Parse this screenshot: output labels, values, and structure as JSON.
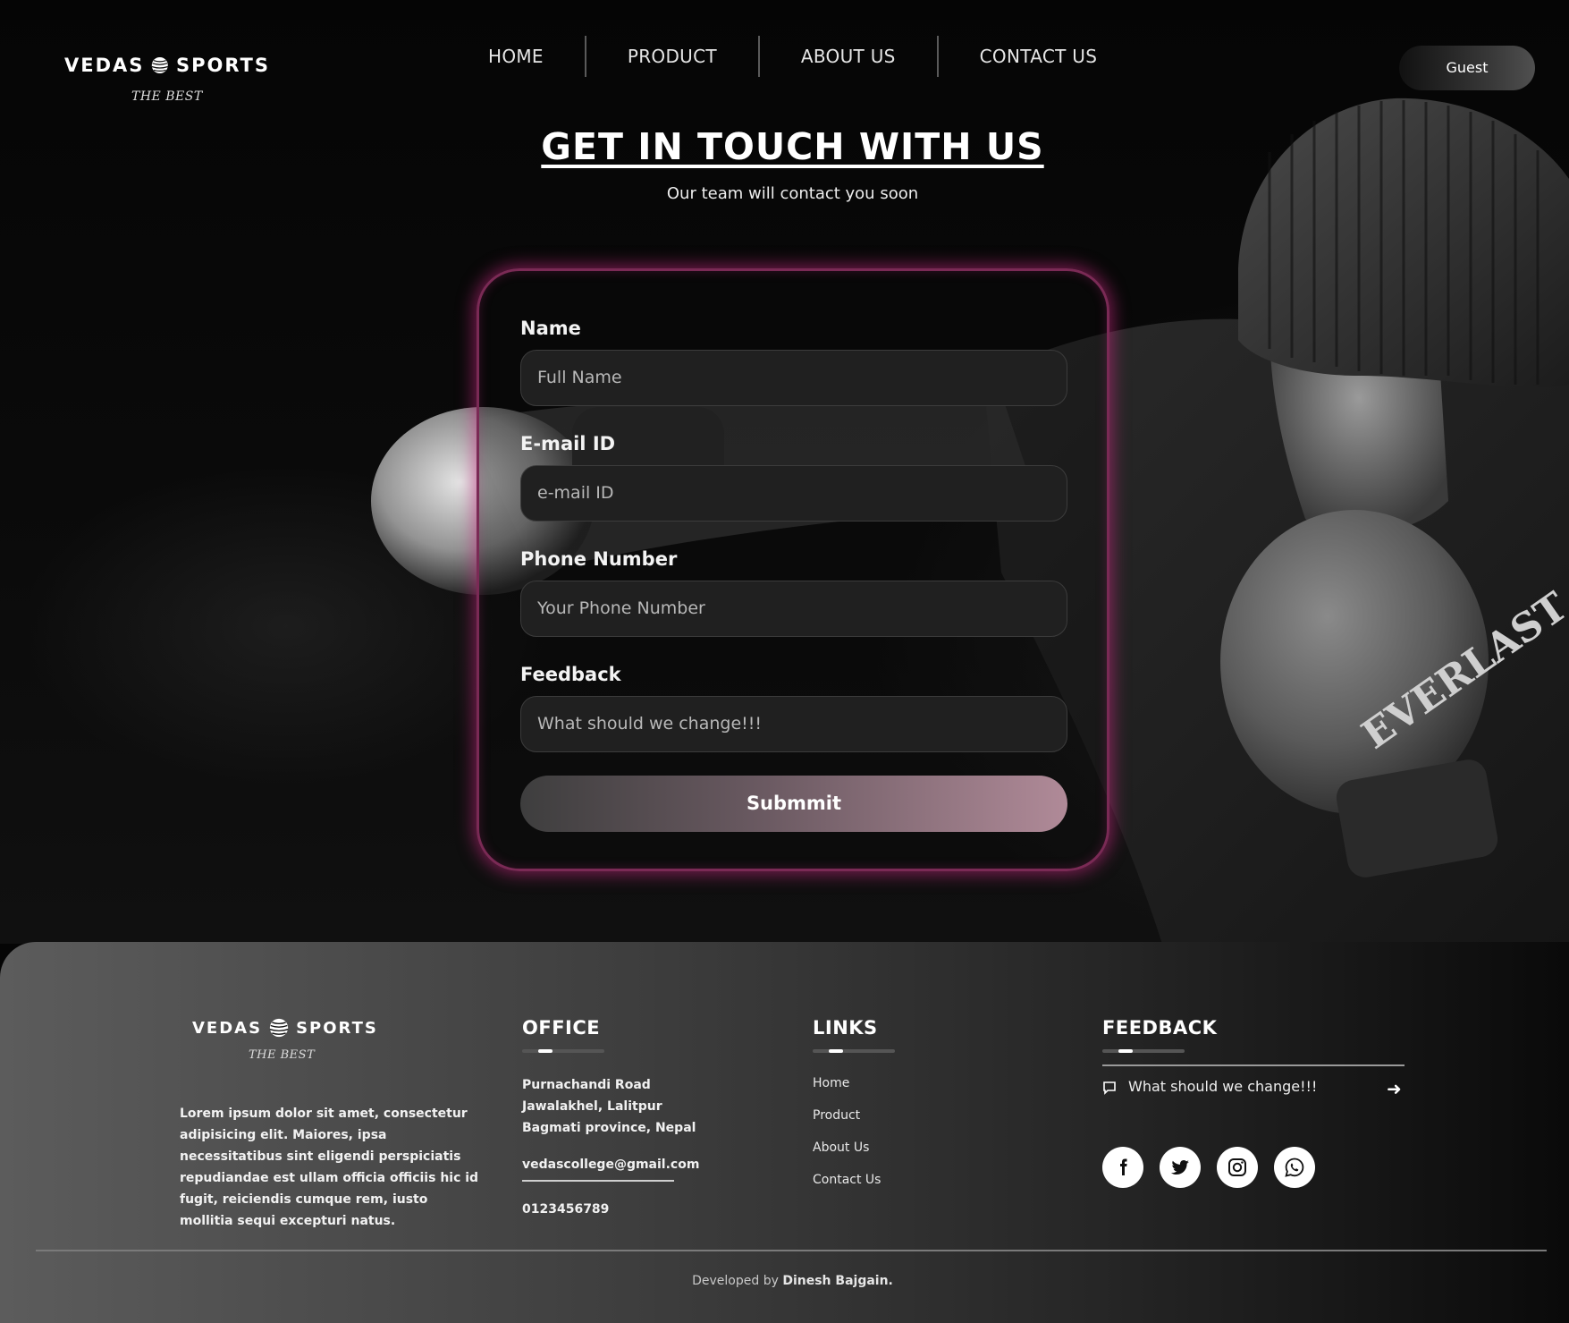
{
  "brand": {
    "name_left": "VEDAS",
    "name_right": "SPORTS",
    "tagline": "THE BEST"
  },
  "nav": {
    "items": [
      "HOME",
      "PRODUCT",
      "ABOUT US",
      "CONTACT US"
    ]
  },
  "user": {
    "label": "Guest"
  },
  "hero": {
    "title": "GET IN TOUCH WITH US",
    "subtitle": "Our team will contact you soon"
  },
  "form": {
    "name": {
      "label": "Name",
      "placeholder": "Full Name"
    },
    "email": {
      "label": "E-mail ID",
      "placeholder": "e-mail ID"
    },
    "phone": {
      "label": "Phone Number",
      "placeholder": "Your Phone Number"
    },
    "feedback": {
      "label": "Feedback",
      "placeholder": "What should we change!!!"
    },
    "submit_label": "Submmit"
  },
  "footer": {
    "about": "Lorem ipsum dolor sit amet, consectetur adipisicing elit. Maiores, ipsa necessitatibus sint eligendi perspiciatis repudiandae est ullam officia officiis hic id fugit, reiciendis cumque rem, iusto mollitia sequi excepturi natus.",
    "office": {
      "title": "OFFICE",
      "address_line1": "Purnachandi Road",
      "address_line2": "Jawalakhel, Lalitpur",
      "address_line3": "Bagmati province, Nepal",
      "email": "vedascollege@gmail.com",
      "phone": "0123456789"
    },
    "links": {
      "title": "LINKS",
      "items": [
        "Home",
        "Product",
        "About Us",
        "Contact Us"
      ]
    },
    "feedback": {
      "title": "FEEDBACK",
      "placeholder": "What should we change!!!"
    },
    "social": [
      "facebook-icon",
      "twitter-icon",
      "instagram-icon",
      "whatsapp-icon"
    ],
    "credit_prefix": "Developed by",
    "credit_name": "Dinesh Bajgain."
  },
  "colors": {
    "glow": "#c8288a",
    "accent_pink": "#b08a98",
    "background": "#050505"
  }
}
